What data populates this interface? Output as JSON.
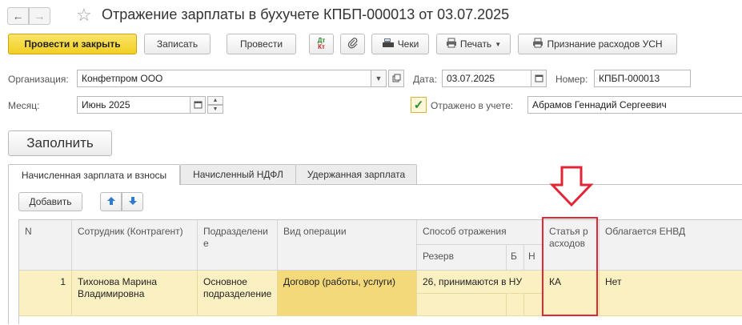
{
  "window": {
    "title": "Отражение зарплаты в бухучете КПБП-000013 от 03.07.2025",
    "nav_back": "←",
    "nav_forward": "→",
    "favorite_icon": "☆"
  },
  "toolbar": {
    "post_close": "Провести и закрыть",
    "save": "Записать",
    "post": "Провести",
    "dt_label": "Дт",
    "kt_label": "Кт",
    "receipts": "Чеки",
    "print": "Печать",
    "usn_expenses": "Признание расходов УСН",
    "icons": [
      "dt-kt-icon",
      "paperclip-icon",
      "cash-register-icon",
      "printer-icon",
      "printer-icon"
    ]
  },
  "form": {
    "org_label": "Организация:",
    "org_value": "Конфетпром ООО",
    "date_label": "Дата:",
    "date_value": "03.07.2025",
    "number_label": "Номер:",
    "number_value": "КПБП-000013",
    "month_label": "Месяц:",
    "month_value": "Июнь 2025",
    "reflected_label": "Отражено в учете:",
    "reflected_checked": true,
    "person_value": "Абрамов Геннадий Сергеевич"
  },
  "fill_button": "Заполнить",
  "tabs": [
    {
      "label": "Начисленная зарплата и взносы",
      "active": true
    },
    {
      "label": "Начисленный НДФЛ",
      "active": false
    },
    {
      "label": "Удержанная зарплата",
      "active": false
    }
  ],
  "table_toolbar": {
    "add": "Добавить"
  },
  "table": {
    "headers": {
      "n": "N",
      "employee": "Сотрудник (Контрагент)",
      "department": "Подразделение",
      "operation": "Вид операции",
      "method": "Способ отражения",
      "reserve": "Резерв",
      "b": "Б",
      "n_short": "Н",
      "expense_item": "Статья расходов",
      "envd": "Облагается ЕНВД"
    },
    "rows": [
      {
        "n": "1",
        "employee": "Тихонова Марина Владимировна",
        "department": "Основное подразделение",
        "operation": "Договор (работы, услуги)",
        "method": "26, принимаются в НУ",
        "expense_item": "КА",
        "envd": "Нет"
      }
    ]
  },
  "annotation": {
    "color": "#e32636"
  }
}
